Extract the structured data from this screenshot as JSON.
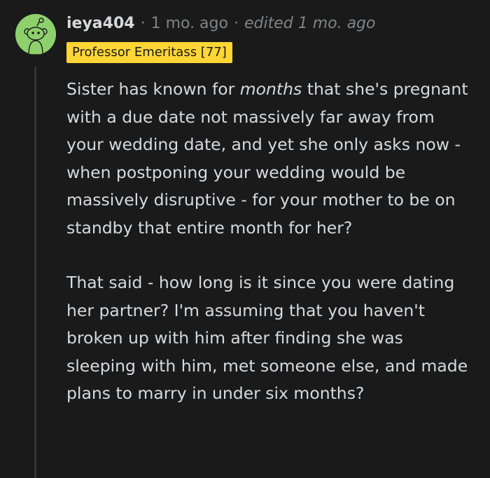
{
  "comment": {
    "username": "ieya404",
    "separator": "·",
    "time": "1 mo. ago",
    "edited": "edited 1 mo. ago",
    "flair": "Professor Emeritass [77]",
    "paragraph1": {
      "before": "Sister has known for ",
      "emphasis": "months",
      "after": " that she's pregnant with a due date not massively far away from your wedding date, and yet she only asks now - when postponing your wedding would be massively disruptive - for your mother to be on standby that entire month for her?"
    },
    "paragraph2": "That said - how long is it since you were dating her partner? I'm assuming that you haven't broken up with him after finding she was sleeping with him, met someone else, and made plans to marry in under six months?"
  },
  "colors": {
    "background": "#1a1a1b",
    "text": "#d7dadc",
    "muted": "#818384",
    "flair_background": "#ffd635",
    "avatar_background": "#8ed16c"
  },
  "icons": {
    "avatar": "snoo-avatar-icon"
  }
}
